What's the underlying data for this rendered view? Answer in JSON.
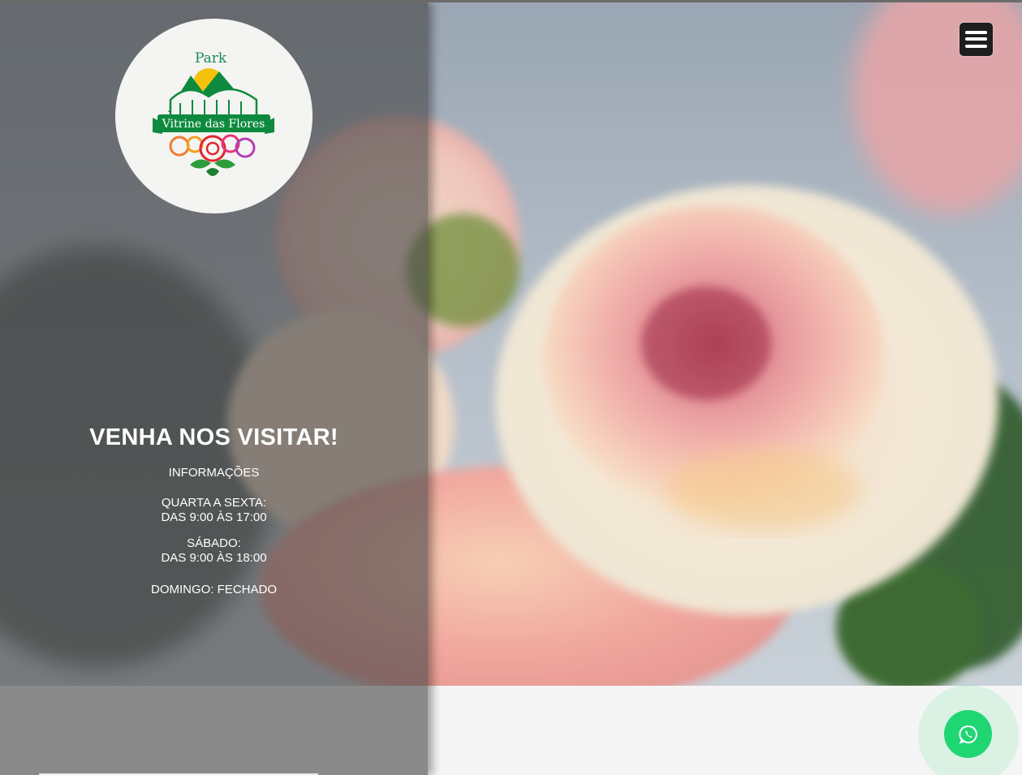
{
  "header": {
    "menu_icon": "hamburger-menu-icon"
  },
  "logo": {
    "park_text": "Park",
    "name_text": "Vitrine das Flores",
    "icon": "greenhouse-roses-logo"
  },
  "visit": {
    "title": "VENHA NOS VISITAR!",
    "info_label": "INFORMAÇÕES",
    "weekday_label": "QUARTA A SEXTA:",
    "weekday_hours": "DAS 9:00 ÀS 17:00",
    "saturday_label": "SÁBADO:",
    "saturday_hours": "DAS 9:00 ÀS 18:00",
    "sunday": "DOMINGO: FECHADO"
  },
  "whatsapp": {
    "icon": "whatsapp-icon",
    "color": "#1fd673"
  },
  "colors": {
    "panel_overlay": "#464646",
    "logo_green": "#0e8a3e",
    "logo_yellow": "#f4c20d"
  }
}
